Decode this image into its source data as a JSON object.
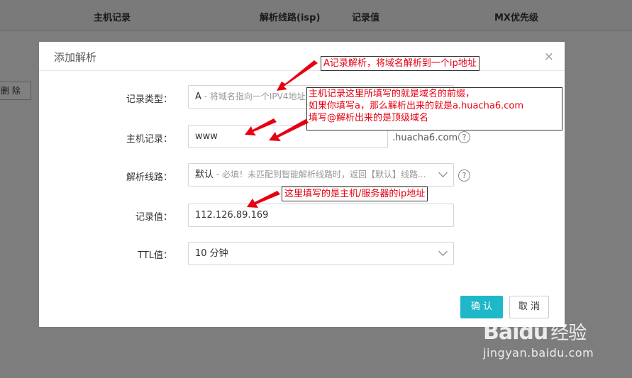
{
  "background": {
    "columns": [
      "主机记录",
      "解析线路(isp)",
      "记录值",
      "MX优先级"
    ],
    "delete_label": "删 除"
  },
  "dialog": {
    "title": "添加解析",
    "close": "×",
    "record_type": {
      "label": "记录类型：",
      "value": "A",
      "hint": " - 将域名指向一个IPV4地址"
    },
    "host": {
      "label": "主机记录：",
      "value": "www",
      "suffix": ".huacha6.com"
    },
    "line": {
      "label": "解析线路：",
      "value": "默认",
      "hint": " - 必填！未匹配到智能解析线路时，返回【默认】线路..."
    },
    "record_value": {
      "label": "记录值：",
      "value": "112.126.89.169"
    },
    "ttl": {
      "label": "TTL值：",
      "value": "10 分钟"
    },
    "help": "?",
    "ok_label": "确 认",
    "cancel_label": "取 消"
  },
  "annotations": {
    "a_record": "A记录解析，将域名解析到一个ip地址",
    "host_line1": "主机记录这里所填写的就是域名的前缀，",
    "host_line2": "如果你填写a，那么解析出来的就是a.huacha6.com",
    "host_line3": "填写@解析出来的是顶级域名",
    "value_note": "这里填写的是主机/服务器的ip地址"
  },
  "watermark": {
    "logo": "Bai",
    "logo_paw": "du",
    "logo_cn": "经验",
    "url": "jingyan.baidu.com"
  },
  "colors": {
    "annotation_red": "#e60012",
    "ok_button": "#1fb8c8"
  },
  "icons": [
    "close-icon",
    "help-icon",
    "chevron-down-icon",
    "arrow-icon"
  ]
}
